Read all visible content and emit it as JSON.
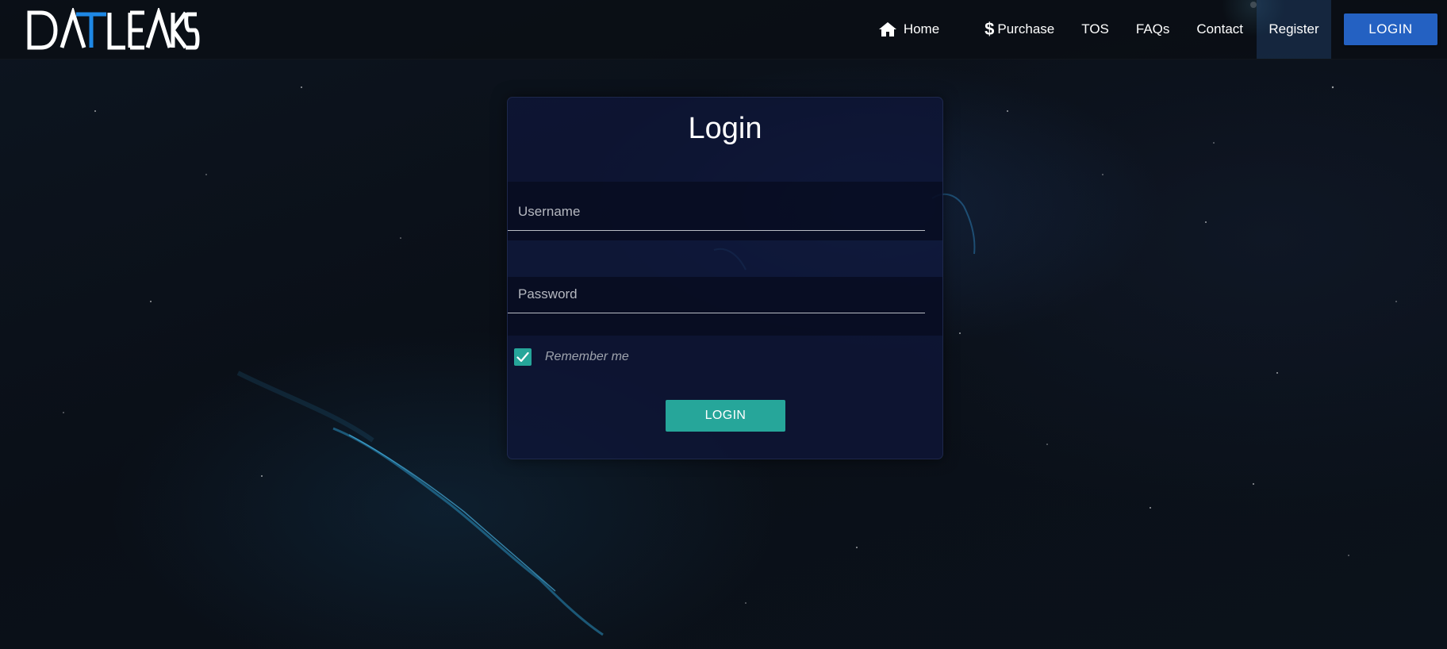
{
  "brand": {
    "logo_text": "DATALEAKS"
  },
  "nav": {
    "home": "Home",
    "purchase": "Purchase",
    "tos": "TOS",
    "faqs": "FAQs",
    "contact": "Contact",
    "register": "Register",
    "login_button": "LOGIN"
  },
  "login_form": {
    "title": "Login",
    "username_placeholder": "Username",
    "password_placeholder": "Password",
    "remember_label": "Remember me",
    "remember_checked": true,
    "submit_label": "LOGIN"
  },
  "colors": {
    "accent_teal": "#26a69a",
    "nav_login_blue": "#2461c2",
    "card_bg": "#0e1638"
  },
  "icons": {
    "home": "home-icon",
    "purchase": "dollar-icon",
    "checkbox": "checkmark-icon"
  }
}
